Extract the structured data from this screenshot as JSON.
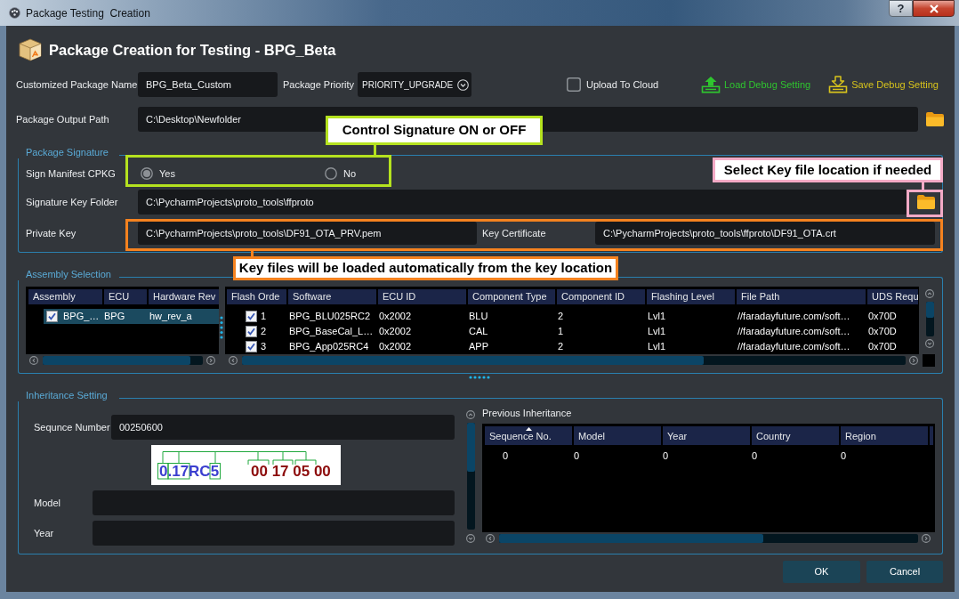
{
  "window": {
    "title": "Package Testing  Creation",
    "help_button": "?"
  },
  "header": {
    "title": "Package Creation for Testing - BPG_Beta"
  },
  "package_name": {
    "label": "Customized Package Name",
    "value": "BPG_Beta_Custom"
  },
  "package_priority": {
    "label": "Package Priority",
    "value": "PRIORITY_UPGRADE"
  },
  "upload_to_cloud": {
    "label": "Upload To Cloud",
    "checked": false
  },
  "debug_actions": [
    {
      "kind": "load",
      "label": "Load Debug Setting"
    },
    {
      "kind": "save",
      "label": "Save Debug Setting"
    }
  ],
  "output_path": {
    "label": "Package Output Path",
    "value": "C:\\Desktop\\Newfolder"
  },
  "package_signature": {
    "title": "Package Signature",
    "sign_manifest": {
      "label": "Sign Manifest CPKG",
      "options": [
        {
          "label": "Yes",
          "selected": true
        },
        {
          "label": "No",
          "selected": false
        }
      ]
    },
    "key_folder": {
      "label": "Signature Key Folder",
      "value": "C:\\PycharmProjects\\proto_tools\\ffproto"
    },
    "private_key": {
      "label": "Private Key",
      "value": "C:\\PycharmProjects\\proto_tools\\DF91_OTA_PRV.pem"
    },
    "key_certificate": {
      "label": "Key Certificate",
      "value": "C:\\PycharmProjects\\proto_tools\\ffproto\\DF91_OTA.crt"
    }
  },
  "assembly_selection": {
    "title": "Assembly Selection",
    "assemblies": {
      "columns": [
        "Assembly",
        "ECU",
        "Hardware Rev"
      ],
      "rows": [
        {
          "checked": true,
          "selected": true,
          "cells": [
            "BPG_…",
            "BPG",
            "hw_rev_a"
          ]
        }
      ]
    },
    "software": {
      "columns": [
        "Flash Orde",
        "Software",
        "ECU ID",
        "Component Type",
        "Component ID",
        "Flashing Level",
        "File Path",
        "UDS Requ"
      ],
      "rows": [
        {
          "checked": true,
          "cells": [
            "1",
            "BPG_BLU025RC2",
            "0x2002",
            "BLU",
            "2",
            "Lvl1",
            "//faradayfuture.com/soft…",
            "0x70D"
          ]
        },
        {
          "checked": true,
          "cells": [
            "2",
            "BPG_BaseCal_L…",
            "0x2002",
            "CAL",
            "1",
            "Lvl1",
            "//faradayfuture.com/soft…",
            "0x70D"
          ]
        },
        {
          "checked": true,
          "cells": [
            "3",
            "BPG_App025RC4",
            "0x2002",
            "APP",
            "2",
            "Lvl1",
            "//faradayfuture.com/soft…",
            "0x70D"
          ]
        }
      ]
    }
  },
  "inheritance_setting": {
    "title": "Inheritance Setting",
    "sequence_number": {
      "label": "Sequnce Number",
      "value": "00250600"
    },
    "sequence_diagram": {
      "version": "0.17RC5",
      "sequence": "00 17 05 00"
    },
    "model": {
      "label": "Model"
    },
    "year": {
      "label": "Year"
    },
    "previous_inheritance": {
      "title": "Previous Inheritance",
      "columns": [
        {
          "label": "Sequence No.",
          "sorted": true
        },
        {
          "label": "Model",
          "sorted": false
        },
        {
          "label": "Year",
          "sorted": false
        },
        {
          "label": "Country",
          "sorted": false
        },
        {
          "label": "Region",
          "sorted": false
        }
      ],
      "rows": [
        [
          "0",
          "0",
          "0",
          "0",
          "0"
        ]
      ]
    }
  },
  "buttons": [
    "OK",
    "Cancel"
  ],
  "annotations": [
    {
      "text": "Control Signature ON or OFF",
      "color": "#b5e21f"
    },
    {
      "text": "Select Key file location if needed",
      "color": "#f4aac6"
    },
    {
      "text": "Key files will be loaded automatically from the key location",
      "color": "#f5821f"
    }
  ]
}
